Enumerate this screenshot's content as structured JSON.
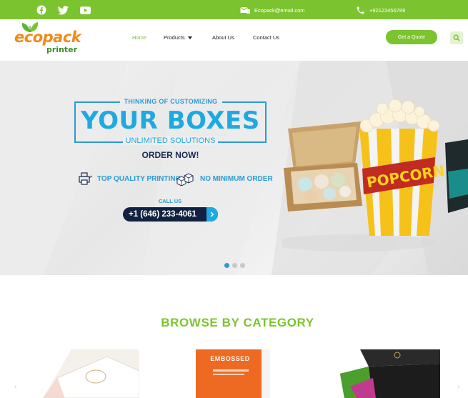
{
  "topbar": {
    "social": [
      {
        "icon": "facebook-icon"
      },
      {
        "icon": "twitter-icon"
      },
      {
        "icon": "youtube-icon"
      }
    ],
    "email": "Ecopack@email.com",
    "phone": "+92123456789",
    "color": "#7cc42f"
  },
  "header": {
    "logo_top": "ecopack",
    "logo_bottom": "printer",
    "nav": [
      {
        "label": "Home",
        "active": true
      },
      {
        "label": "Products",
        "dropdown": true
      },
      {
        "label": "About Us"
      },
      {
        "label": "Contact Us"
      }
    ],
    "quote_label": "Get a Quote",
    "search_icon": "search-icon"
  },
  "hero": {
    "subtitle": "THINKING OF CUSTOMIZING",
    "headline": "YOUR BOXES",
    "tagline": "UNLIMITED SOLUTIONS",
    "order": "ORDER NOW!",
    "feature_1": "TOP QUALITY PRINTING",
    "feature_2": "NO MINIMUM ORDER",
    "call_us": "CALL US",
    "phone": "+1 (646) 233-4061",
    "popcorn": "POPCORN",
    "slides_total": 3,
    "active_slide": 1,
    "accent": "#2a9bd7"
  },
  "browse": {
    "title": "BROWSE BY CATEGORY",
    "emboss_text": "EMBOSSED"
  }
}
